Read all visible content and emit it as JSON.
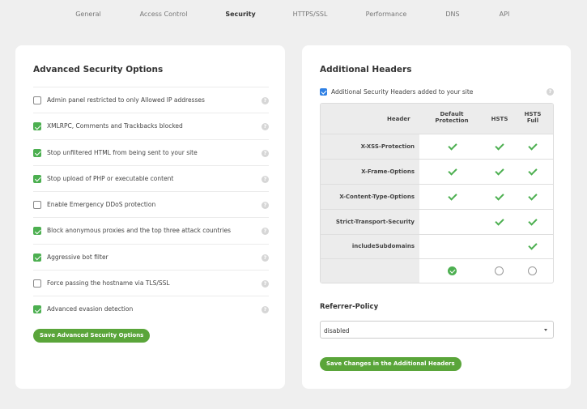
{
  "nav": {
    "tabs": [
      "General",
      "Access Control",
      "Security",
      "HTTPS/SSL",
      "Performance",
      "DNS",
      "API"
    ],
    "active": "Security"
  },
  "advanced": {
    "title": "Advanced Security Options",
    "options": [
      {
        "label": "Admin panel restricted to only Allowed IP addresses",
        "checked": false
      },
      {
        "label": "XMLRPC, Comments and Trackbacks blocked",
        "checked": true
      },
      {
        "label": "Stop unfiltered HTML from being sent to your site",
        "checked": true
      },
      {
        "label": "Stop upload of PHP or executable content",
        "checked": true
      },
      {
        "label": "Enable Emergency DDoS protection",
        "checked": false
      },
      {
        "label": "Block anonymous proxies and the top three attack countries",
        "checked": true
      },
      {
        "label": "Aggressive bot filter",
        "checked": true
      },
      {
        "label": "Force passing the hostname via TLS/SSL",
        "checked": false
      },
      {
        "label": "Advanced evasion detection",
        "checked": true
      }
    ],
    "save_label": "Save Advanced Security Options",
    "help_glyph": "?"
  },
  "headers": {
    "title": "Additional Headers",
    "toggle_label": "Additional Security Headers added to your site",
    "toggle_checked": true,
    "columns": {
      "header": "Header",
      "default_l1": "Default",
      "default_l2": "Protection",
      "hsts": "HSTS",
      "hsts_full_l1": "HSTS",
      "hsts_full_l2": "Full"
    },
    "rows": [
      {
        "name": "X-XSS-Protection",
        "default": true,
        "hsts": true,
        "hsts_full": true
      },
      {
        "name": "X-Frame-Options",
        "default": true,
        "hsts": true,
        "hsts_full": true
      },
      {
        "name": "X-Content-Type-Options",
        "default": true,
        "hsts": true,
        "hsts_full": true
      },
      {
        "name": "Strict-Transport-Security",
        "default": false,
        "hsts": true,
        "hsts_full": true
      },
      {
        "name": "includeSubdomains",
        "default": false,
        "hsts": false,
        "hsts_full": true
      }
    ],
    "selected_profile": "default",
    "referrer_title": "Referrer-Policy",
    "referrer_value": "disabled",
    "save_label": "Save Changes in the Additional Headers"
  },
  "colors": {
    "accent": "#5aa53a",
    "check": "#4caf50",
    "toggle": "#2f80e4",
    "background": "#efefef"
  }
}
